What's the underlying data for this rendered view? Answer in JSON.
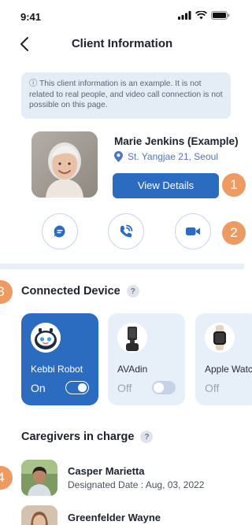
{
  "status_bar": {
    "time": "9:41"
  },
  "header": {
    "title": "Client Information"
  },
  "notice": {
    "text": "ⓘ This client information is an example. It is not related to real people, and video call connection is not possible on this page."
  },
  "client": {
    "name": "Marie Jenkins (Example)",
    "address": "St. Yangjae 21, Seoul",
    "view_details_label": "View Details"
  },
  "badges": [
    "1",
    "2",
    "3",
    "4"
  ],
  "actions": [
    {
      "icon": "chat-bubble-icon"
    },
    {
      "icon": "phone-call-icon"
    },
    {
      "icon": "video-camera-icon"
    }
  ],
  "connected_device": {
    "title": "Connected Device",
    "help": "?",
    "devices": [
      {
        "name": "Kebbi Robot",
        "state": "On",
        "on": true,
        "icon": "robot-icon"
      },
      {
        "name": "AVAdin",
        "state": "Off",
        "on": false,
        "icon": "tablet-speaker-icon"
      },
      {
        "name": "Apple Watch",
        "state": "Off",
        "on": false,
        "icon": "watch-icon"
      }
    ]
  },
  "caregivers": {
    "title": "Caregivers in charge",
    "help": "?",
    "items": [
      {
        "name": "Casper Marietta",
        "date": "Designated Date : Aug, 03, 2022"
      },
      {
        "name": "Greenfelder Wayne",
        "date": ""
      }
    ]
  },
  "colors": {
    "primary": "#2b6cc0",
    "badge": "#ee9a63",
    "notice_bg": "#e4ecf6",
    "card_bg": "#e7eff9"
  }
}
